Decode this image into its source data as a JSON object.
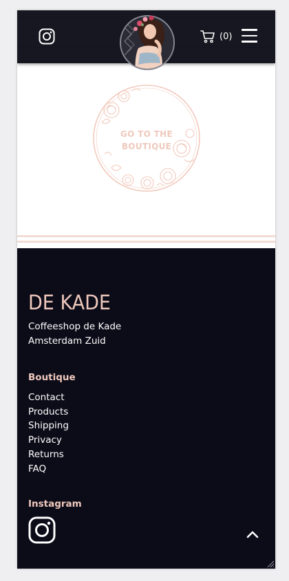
{
  "header": {
    "instagram_icon": "instagram-icon",
    "logo_icon": "lady-portrait-logo",
    "cart_count": "(0)",
    "menu_icon": "hamburger-menu-icon"
  },
  "main": {
    "boutique_line1": "GO TO THE",
    "boutique_line2": "BOUTIQUE"
  },
  "footer": {
    "brand": "DE KADE",
    "address_line1": "Coffeeshop de Kade",
    "address_line2": "Amsterdam Zuid",
    "boutique_title": "Boutique",
    "links": [
      "Contact",
      "Products",
      "Shipping",
      "Privacy",
      "Returns",
      "FAQ"
    ],
    "instagram_title": "Instagram",
    "back_to_top_icon": "chevron-up-icon"
  },
  "colors": {
    "header_bg": "#15151f",
    "footer_bg": "#0c0b18",
    "accent_peach": "#efc9bd",
    "stripe": "#f2dcd4"
  }
}
